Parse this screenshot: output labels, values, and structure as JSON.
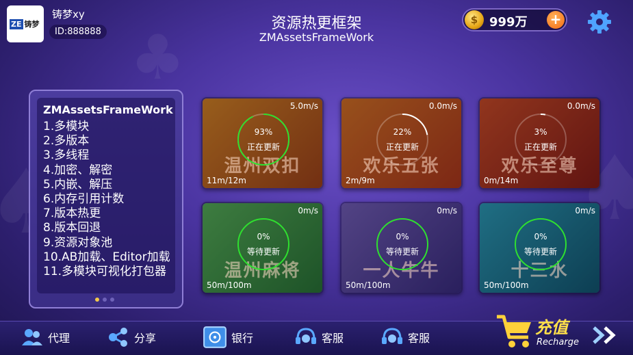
{
  "header": {
    "avatar_logo_text": "铸梦",
    "username": "铸梦xy",
    "user_id": "ID:888888",
    "title": "资源热更框架",
    "subtitle": "ZMAssetsFrameWork",
    "gold": "999万"
  },
  "features": {
    "title": "ZMAssetsFrameWork",
    "items": [
      "1.多模块",
      "2.多版本",
      "3.多线程",
      "4.加密、解密",
      "5.内嵌、解压",
      "6.内存引用计数",
      "7.版本热更",
      "8.版本回退",
      "9.资源对象池",
      "10.AB加载、Editor加载",
      "11.多模块可视化打包器"
    ]
  },
  "games": [
    {
      "name": "温州双扣",
      "speed": "5.0m/s",
      "size": "11m/12m",
      "percent": "93%",
      "status": "正在更新",
      "progress": 0.93
    },
    {
      "name": "欢乐五张",
      "speed": "0.0m/s",
      "size": "2m/9m",
      "percent": "22%",
      "status": "正在更新",
      "progress": 0.22
    },
    {
      "name": "欢乐至尊",
      "speed": "0.0m/s",
      "size": "0m/14m",
      "percent": "3%",
      "status": "正在更新",
      "progress": 0.03
    },
    {
      "name": "温州麻将",
      "speed": "0m/s",
      "size": "50m/100m",
      "percent": "0%",
      "status": "等待更新",
      "progress": 0
    },
    {
      "name": "一人牛牛",
      "speed": "0m/s",
      "size": "50m/100m",
      "percent": "0%",
      "status": "等待更新",
      "progress": 0
    },
    {
      "name": "十三水",
      "speed": "0m/s",
      "size": "50m/100m",
      "percent": "0%",
      "status": "等待更新",
      "progress": 0
    }
  ],
  "nav": {
    "agent": "代理",
    "share": "分享",
    "bank": "银行",
    "service1": "客服",
    "service2": "客服",
    "recharge_cn": "充值",
    "recharge_en": "Recharge"
  },
  "colors": {
    "accent_gold": "#ffe04a",
    "ring_active": "#ffffff",
    "ring_waiting": "#2fe02f",
    "card_orange": "#c9651d",
    "card_green": "#3f9a4a",
    "card_purple": "#5e4aa6",
    "card_teal": "#1f7f9a"
  },
  "icons": [
    "gear-icon",
    "coin-icon",
    "plus-icon",
    "agent-icon",
    "share-icon",
    "bank-icon",
    "headset-icon",
    "cart-icon",
    "double-chevron-icon"
  ]
}
